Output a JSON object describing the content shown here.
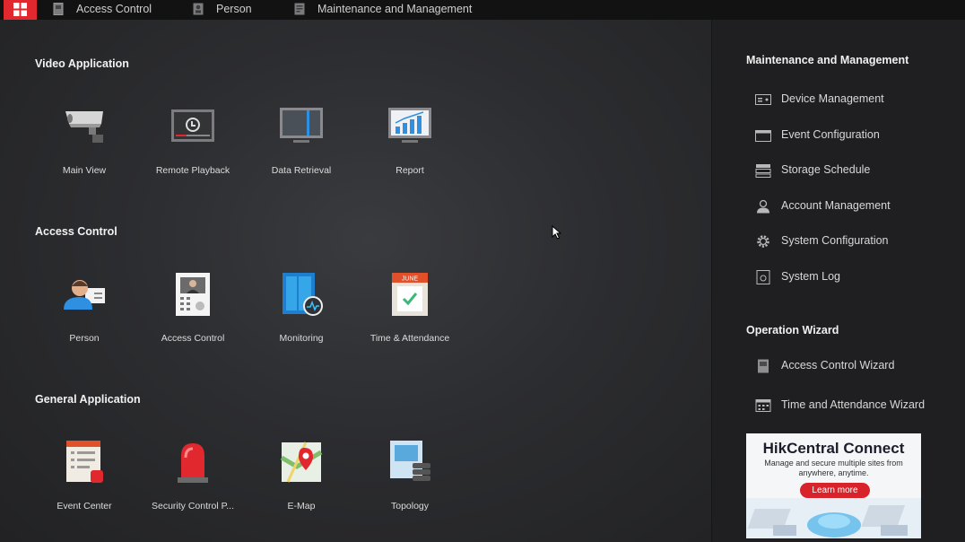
{
  "topbar": {
    "tabs": [
      {
        "label": "Access Control",
        "icon": "door-panel-icon"
      },
      {
        "label": "Person",
        "icon": "id-card-icon"
      },
      {
        "label": "Maintenance and Management",
        "icon": "maintenance-icon"
      }
    ],
    "home_icon": "grid-icon",
    "accent": "#e2282f"
  },
  "sections": [
    {
      "title": "Video Application",
      "items": [
        {
          "label": "Main View",
          "icon": "camera-icon"
        },
        {
          "label": "Remote Playback",
          "icon": "playback-icon"
        },
        {
          "label": "Data Retrieval",
          "icon": "monitor-search-icon"
        },
        {
          "label": "Report",
          "icon": "bar-chart-icon"
        }
      ]
    },
    {
      "title": "Access Control",
      "items": [
        {
          "label": "Person",
          "icon": "person-card-icon"
        },
        {
          "label": "Access Control",
          "icon": "intercom-icon"
        },
        {
          "label": "Monitoring",
          "icon": "door-monitor-icon"
        },
        {
          "label": "Time & Attendance",
          "icon": "calendar-icon",
          "icon_text": "JUNE"
        }
      ]
    },
    {
      "title": "General Application",
      "items": [
        {
          "label": "Event Center",
          "icon": "event-list-icon"
        },
        {
          "label": "Security Control P...",
          "icon": "alarm-light-icon"
        },
        {
          "label": "E-Map",
          "icon": "map-pin-icon"
        },
        {
          "label": "Topology",
          "icon": "topology-icon"
        }
      ]
    }
  ],
  "sidebar": {
    "maintenance_title": "Maintenance and Management",
    "maintenance_items": [
      {
        "label": "Device Management",
        "icon": "device-icon"
      },
      {
        "label": "Event Configuration",
        "icon": "event-config-icon"
      },
      {
        "label": "Storage Schedule",
        "icon": "storage-icon"
      },
      {
        "label": "Account Management",
        "icon": "user-icon"
      },
      {
        "label": "System Configuration",
        "icon": "gear-icon"
      },
      {
        "label": "System Log",
        "icon": "log-icon"
      }
    ],
    "wizard_title": "Operation Wizard",
    "wizard_items": [
      {
        "label": "Access Control Wizard",
        "icon": "door-panel-icon"
      },
      {
        "label": "Time and Attendance Wizard",
        "icon": "calendar-grid-icon"
      }
    ],
    "ad": {
      "title": "HikCentral Connect",
      "subtitle": "Manage and secure multiple sites from anywhere, anytime.",
      "button": "Learn more"
    }
  }
}
